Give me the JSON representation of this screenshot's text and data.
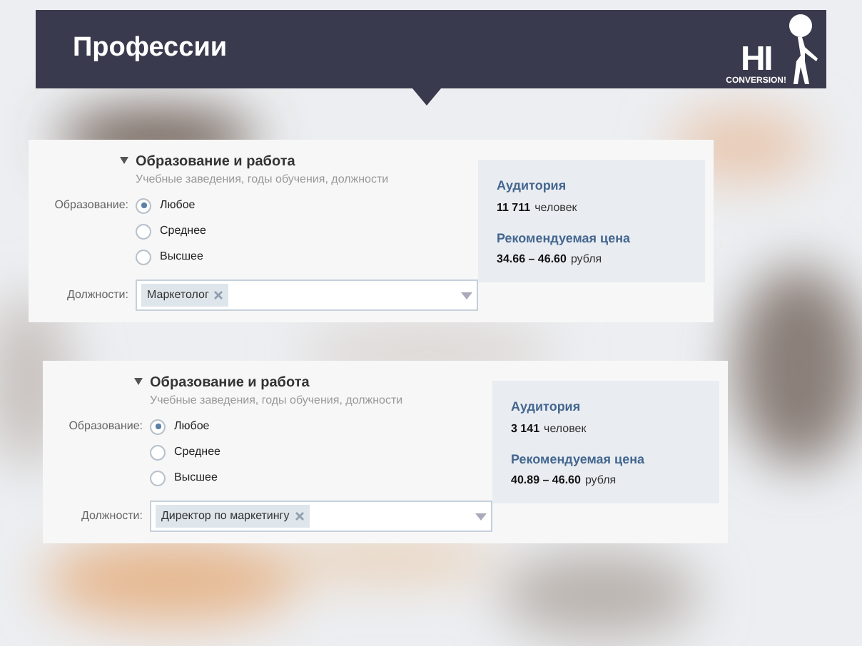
{
  "header": {
    "title": "Профессии",
    "logo": {
      "mark": "HI",
      "text": "CONVERSION!"
    }
  },
  "panels": [
    {
      "section_title": "Образование и работа",
      "subtitle": "Учебные заведения, годы обучения, должности",
      "education_label": "Образование:",
      "options": [
        {
          "label": "Любое",
          "selected": true
        },
        {
          "label": "Среднее",
          "selected": false
        },
        {
          "label": "Высшее",
          "selected": false
        }
      ],
      "positions_label": "Должности:",
      "tag": "Маркетолог",
      "audience_label": "Аудитория",
      "audience_value": "11 711",
      "audience_unit": "человек",
      "price_label": "Рекомендуемая цена",
      "price_value": "34.66 – 46.60",
      "price_unit": "рубля"
    },
    {
      "section_title": "Образование и работа",
      "subtitle": "Учебные заведения, годы обучения, должности",
      "education_label": "Образование:",
      "options": [
        {
          "label": "Любое",
          "selected": true
        },
        {
          "label": "Среднее",
          "selected": false
        },
        {
          "label": "Высшее",
          "selected": false
        }
      ],
      "positions_label": "Должности:",
      "tag": "Директор по маркетингу",
      "audience_label": "Аудитория",
      "audience_value": "3 141",
      "audience_unit": "человек",
      "price_label": "Рекомендуемая цена",
      "price_value": "40.89 – 46.60",
      "price_unit": "рубля"
    }
  ]
}
